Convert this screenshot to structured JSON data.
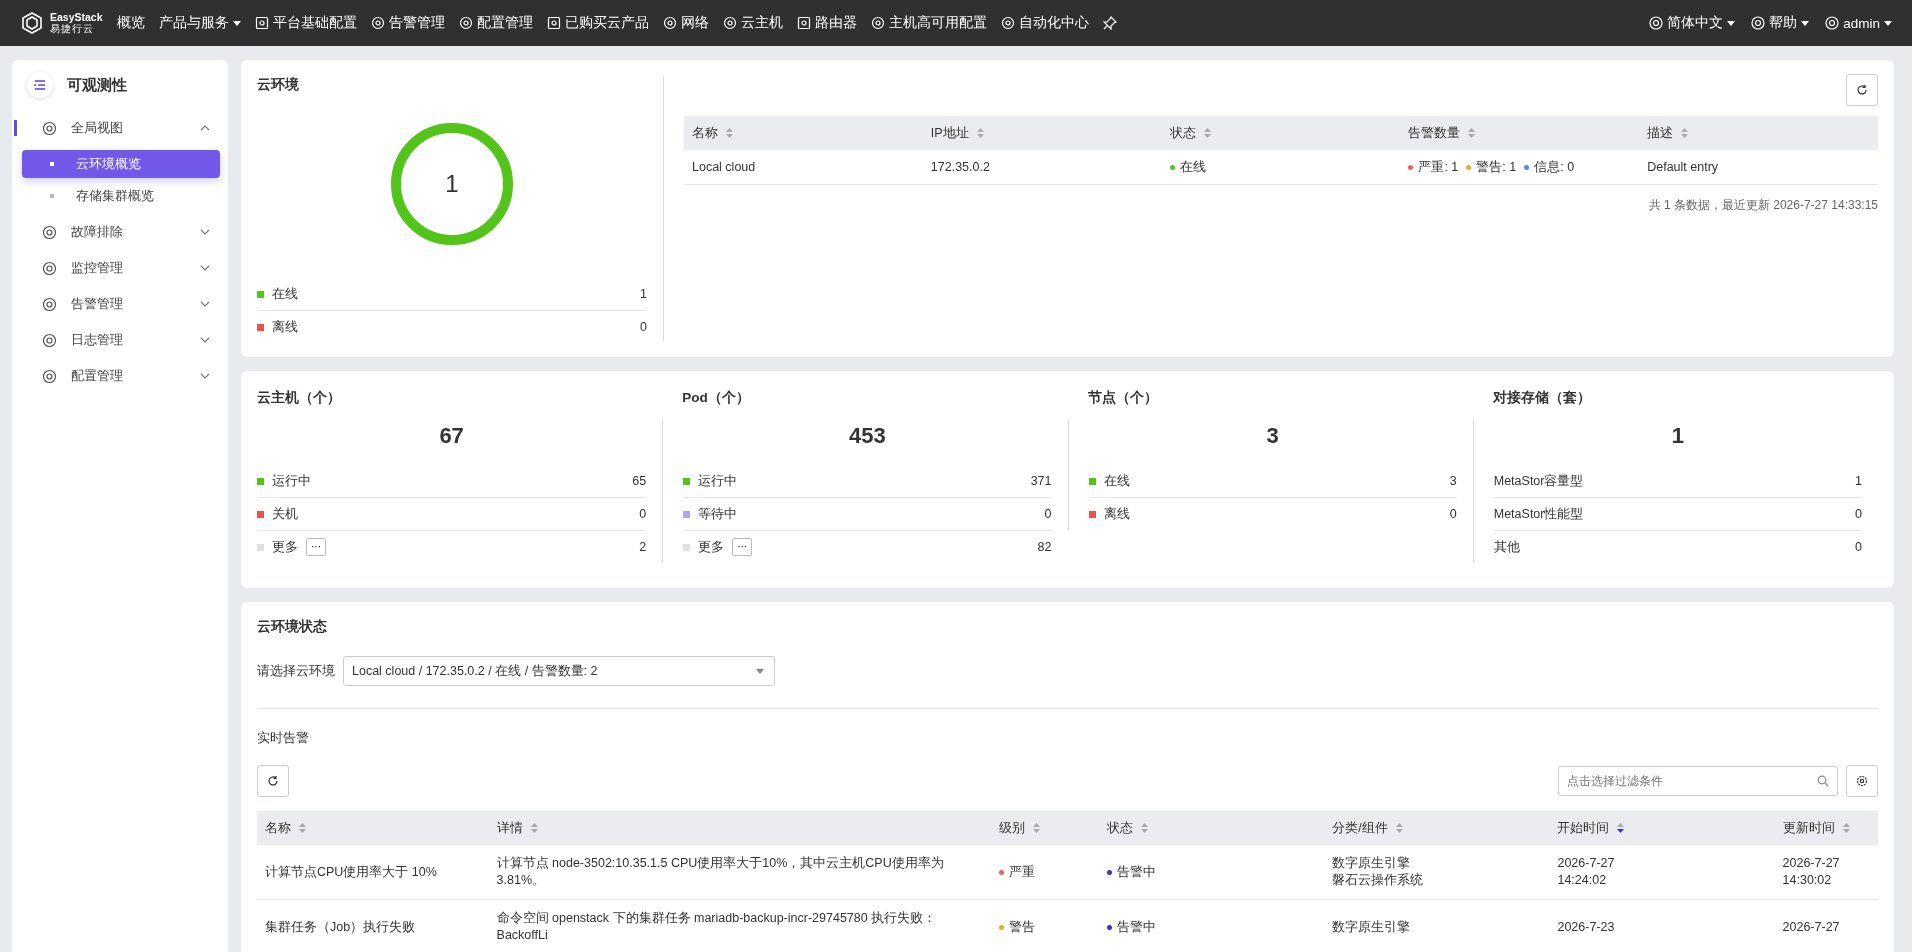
{
  "topbar": {
    "logo": {
      "name": "EasyStack",
      "sub": "易捷行云"
    },
    "nav": [
      {
        "label": "概览",
        "kind": "plain"
      },
      {
        "label": "产品与服务",
        "kind": "dropdown"
      },
      {
        "label": "平台基础配置",
        "kind": "icon"
      },
      {
        "label": "告警管理",
        "kind": "icon"
      },
      {
        "label": "配置管理",
        "kind": "icon"
      },
      {
        "label": "已购买云产品",
        "kind": "icon"
      },
      {
        "label": "网络",
        "kind": "icon"
      },
      {
        "label": "云主机",
        "kind": "icon"
      },
      {
        "label": "路由器",
        "kind": "icon"
      },
      {
        "label": "主机高可用配置",
        "kind": "icon"
      },
      {
        "label": "自动化中心",
        "kind": "icon"
      }
    ],
    "right": [
      {
        "label": "简体中文"
      },
      {
        "label": "帮助"
      },
      {
        "label": "admin"
      }
    ]
  },
  "sidebar": {
    "title": "可观测性",
    "groups": [
      {
        "label": "全局视图",
        "expanded": true,
        "children": [
          {
            "label": "云环境概览",
            "selected": true
          },
          {
            "label": "存储集群概览",
            "selected": false
          }
        ]
      },
      {
        "label": "故障排除",
        "expanded": false
      },
      {
        "label": "监控管理",
        "expanded": false
      },
      {
        "label": "告警管理",
        "expanded": false
      },
      {
        "label": "日志管理",
        "expanded": false
      },
      {
        "label": "配置管理",
        "expanded": false
      }
    ]
  },
  "cloud_env": {
    "title": "云环境",
    "donut": {
      "total": "1",
      "legend": [
        {
          "label": "在线",
          "value": "1",
          "color": "#52c41a"
        },
        {
          "label": "离线",
          "value": "0",
          "color": "#e5534b"
        }
      ]
    },
    "table": {
      "columns": [
        "名称",
        "IP地址",
        "状态",
        "告警数量",
        "描述"
      ],
      "rows": [
        {
          "name": "Local cloud",
          "ip": "172.35.0.2",
          "status": {
            "label": "在线",
            "color": "#52c41a"
          },
          "alerts": [
            {
              "label": "严重: 1",
              "color": "#f0605a"
            },
            {
              "label": "警告: 1",
              "color": "#f5a623"
            },
            {
              "label": "信息: 0",
              "color": "#4a90e2"
            }
          ],
          "description": "Default entry"
        }
      ]
    },
    "footer": "共 1 条数据，最近更新  2026-7-27 14:33:15"
  },
  "stats": [
    {
      "title": "云主机（个）",
      "total": "67",
      "rows": [
        {
          "kind": "dot",
          "label": "运行中",
          "value": "65",
          "color": "#52c41a"
        },
        {
          "kind": "dot",
          "label": "关机",
          "value": "0",
          "color": "#e5534b"
        },
        {
          "kind": "more",
          "label": "更多",
          "button": "···",
          "value": "2",
          "color": "#e0e0e0"
        }
      ]
    },
    {
      "title": "Pod（个）",
      "total": "453",
      "rows": [
        {
          "kind": "dot",
          "label": "运行中",
          "value": "371",
          "color": "#52c41a"
        },
        {
          "kind": "dot",
          "label": "等待中",
          "value": "0",
          "color": "#b0a4f5"
        },
        {
          "kind": "more",
          "label": "更多",
          "button": "···",
          "value": "82",
          "color": "#e0e0e0"
        }
      ]
    },
    {
      "title": "节点（个）",
      "total": "3",
      "rows": [
        {
          "kind": "dot",
          "label": "在线",
          "value": "3",
          "color": "#52c41a"
        },
        {
          "kind": "dot",
          "label": "离线",
          "value": "0",
          "color": "#e5534b"
        }
      ]
    },
    {
      "title": "对接存储（套）",
      "total": "1",
      "rows": [
        {
          "kind": "plain",
          "label": "MetaStor容量型",
          "value": "1"
        },
        {
          "kind": "plain",
          "label": "MetaStor性能型",
          "value": "0"
        },
        {
          "kind": "plain",
          "label": "其他",
          "value": "0"
        }
      ]
    }
  ],
  "env_status": {
    "title": "云环境状态",
    "select_label": "请选择云环境",
    "select_value": "Local cloud / 172.35.0.2 / 在线 / 告警数量: 2",
    "alerts": {
      "title": "实时告警",
      "filter_placeholder": "点击选择过滤条件",
      "columns": [
        {
          "label": "名称",
          "sorted": false
        },
        {
          "label": "详情",
          "sorted": false
        },
        {
          "label": "级别",
          "sorted": false
        },
        {
          "label": "状态",
          "sorted": false
        },
        {
          "label": "分类/组件",
          "sorted": false
        },
        {
          "label": "开始时间",
          "sorted": true
        },
        {
          "label": "更新时间",
          "sorted": false
        }
      ],
      "rows": [
        {
          "name": "计算节点CPU使用率大于 10%",
          "detail": "计算节点 node-3502:10.35.1.5 CPU使用率大于10%，其中云主机CPU使用率为3.81%。",
          "level": {
            "label": "严重",
            "color": "#f0605a"
          },
          "status": {
            "label": "告警中",
            "color": "#3d2fd6"
          },
          "category": [
            "数字原生引擎",
            "磐石云操作系统"
          ],
          "start": [
            "2026-7-27",
            "14:24:02"
          ],
          "update": [
            "2026-7-27",
            "14:30:02"
          ]
        },
        {
          "name": "集群任务（Job）执行失败",
          "detail": "命令空间 openstack 下的集群任务 mariadb-backup-incr-29745780 执行失败：BackoffLi",
          "level": {
            "label": "警告",
            "color": "#f5a623"
          },
          "status": {
            "label": "告警中",
            "color": "#3d2fd6"
          },
          "category": [
            "数字原生引擎"
          ],
          "start": [
            "2026-7-23"
          ],
          "update": [
            "2026-7-27"
          ]
        }
      ]
    }
  }
}
